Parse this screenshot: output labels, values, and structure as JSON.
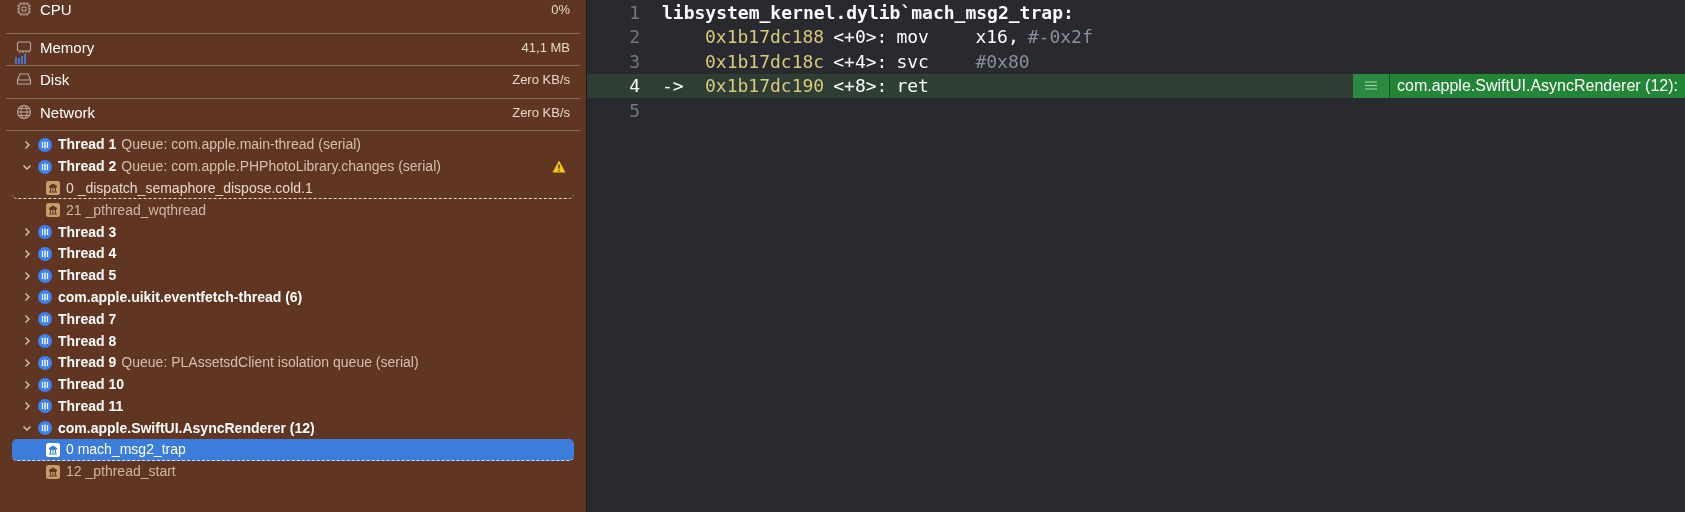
{
  "gauges": [
    {
      "kind": "cpu",
      "label": "CPU",
      "value": "0%"
    },
    {
      "kind": "memory",
      "label": "Memory",
      "value": "41,1 MB"
    },
    {
      "kind": "disk",
      "label": "Disk",
      "value": "Zero KB/s"
    },
    {
      "kind": "network",
      "label": "Network",
      "value": "Zero KB/s"
    }
  ],
  "threads": [
    {
      "name": "Thread 1",
      "queue": "Queue: com.apple.main-thread (serial)",
      "expanded": false,
      "warning": false
    },
    {
      "name": "Thread 2",
      "queue": "Queue: com.apple.PHPhotoLibrary.changes (serial)",
      "expanded": true,
      "warning": true,
      "frames": [
        {
          "label": "0 _dispatch_semaphore_dispose.cold.1",
          "selected": false
        },
        {
          "label": "21 _pthread_wqthread",
          "selected": false
        }
      ]
    },
    {
      "name": "Thread 3",
      "expanded": false,
      "warning": false
    },
    {
      "name": "Thread 4",
      "expanded": false,
      "warning": false
    },
    {
      "name": "Thread 5",
      "expanded": false,
      "warning": false
    },
    {
      "name": "com.apple.uikit.eventfetch-thread (6)",
      "expanded": false,
      "warning": false
    },
    {
      "name": "Thread 7",
      "expanded": false,
      "warning": false
    },
    {
      "name": "Thread 8",
      "expanded": false,
      "warning": false
    },
    {
      "name": "Thread 9",
      "queue": "Queue: PLAssetsdClient isolation queue (serial)",
      "expanded": false,
      "warning": false
    },
    {
      "name": "Thread 10",
      "expanded": false,
      "warning": false
    },
    {
      "name": "Thread 11",
      "expanded": false,
      "warning": false
    },
    {
      "name": "com.apple.SwiftUI.AsyncRenderer (12)",
      "expanded": true,
      "warning": false,
      "frames": [
        {
          "label": "0 mach_msg2_trap",
          "selected": true
        },
        {
          "label": "12 _pthread_start",
          "selected": false
        }
      ]
    }
  ],
  "code": [
    {
      "kind": "label",
      "number": "1",
      "text": "libsystem_kernel.dylib`mach_msg2_trap:",
      "current": false
    },
    {
      "kind": "instruction",
      "number": "2",
      "address": "0x1b17dc188",
      "offset": "<+0>:",
      "mnemonic": "mov",
      "operands": [
        {
          "kind": "register",
          "text": "x16,"
        },
        {
          "kind": "immediate",
          "text": "#-0x2f"
        }
      ],
      "current": false
    },
    {
      "kind": "instruction",
      "number": "3",
      "address": "0x1b17dc18c",
      "offset": "<+4>:",
      "mnemonic": "svc",
      "operands": [
        {
          "kind": "immediate",
          "text": "#0x80"
        }
      ],
      "current": false
    },
    {
      "kind": "instruction",
      "number": "4",
      "arrow": "->",
      "address": "0x1b17dc190",
      "offset": "<+8>:",
      "mnemonic": "ret",
      "current": true,
      "badge": "com.apple.SwiftUI.AsyncRenderer (12):"
    },
    {
      "kind": "empty",
      "number": "5",
      "current": false
    }
  ]
}
